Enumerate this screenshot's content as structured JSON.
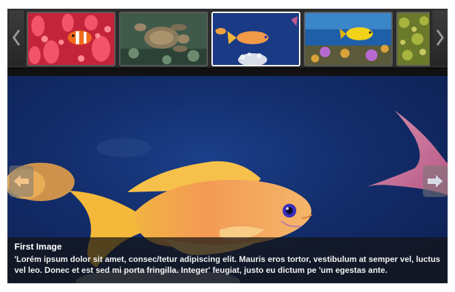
{
  "thumbnails": [
    {
      "name": "anemone-clownfish",
      "active": false
    },
    {
      "name": "sea-turtle",
      "active": false
    },
    {
      "name": "orange-fish",
      "active": true
    },
    {
      "name": "coral-reef-yellow-fish",
      "active": false
    },
    {
      "name": "yellow-coral",
      "active": false
    }
  ],
  "icons": {
    "strip_prev": "chevron-left-icon",
    "strip_next": "chevron-right-icon",
    "stage_prev": "arrow-left-icon",
    "stage_next": "arrow-right-icon"
  },
  "caption": {
    "title": "First Image",
    "text": "'Lorém ipsum dolor sit amet, consec/tetur adipiscing elit. Mauris eros tortor, vestibulum at semper vel, luctus vel leo. Donec et est sed mi porta fringilla. Integer' feugiat, justo eu dictum pe 'um egestas ante."
  },
  "colors": {
    "stage_background": "#132d6b",
    "active_thumb_border": "#ffffff",
    "caption_background": "#141414"
  }
}
